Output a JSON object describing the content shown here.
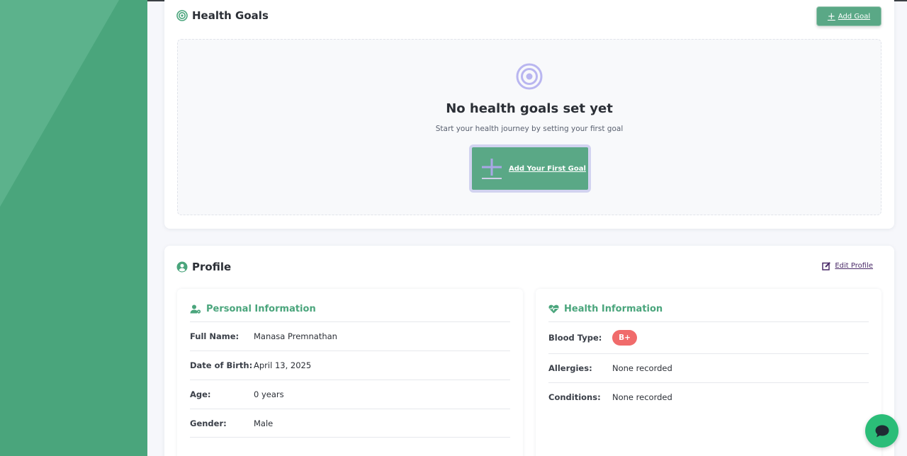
{
  "colors": {
    "brand_green": "#4aa57c",
    "button_green": "#5aa886",
    "target_icon": "#b9b6f0",
    "blood_badge": "#f06b6b",
    "chat_button": "#2bbd78"
  },
  "goals": {
    "title": "Health Goals",
    "title_icon": "target-icon",
    "add_button": {
      "label": "Add Goal",
      "icon": "plus-icon"
    },
    "empty": {
      "icon": "target-icon",
      "title": "No health goals set yet",
      "subtitle": "Start your health journey by setting your first goal",
      "button_label": "Add Your First Goal",
      "button_icon": "plus-icon"
    }
  },
  "profile": {
    "title": "Profile",
    "title_icon": "user-circle-icon",
    "edit_button": {
      "label": "Edit Profile",
      "icon": "edit-icon"
    },
    "personal": {
      "title": "Personal Information",
      "icon": "user-gear-icon",
      "fields": [
        {
          "label": "Full Name:",
          "value": "Manasa Premnathan"
        },
        {
          "label": "Date of Birth:",
          "value": "April 13, 2025"
        },
        {
          "label": "Age:",
          "value": "0 years"
        },
        {
          "label": "Gender:",
          "value": "Male"
        }
      ]
    },
    "health": {
      "title": "Health Information",
      "icon": "heart-pulse-icon",
      "blood_type": {
        "label": "Blood Type:",
        "value": "B+"
      },
      "fields": [
        {
          "label": "Allergies:",
          "value": "None recorded"
        },
        {
          "label": "Conditions:",
          "value": "None recorded"
        }
      ]
    }
  },
  "chat": {
    "icon": "chat-bubble-icon"
  }
}
